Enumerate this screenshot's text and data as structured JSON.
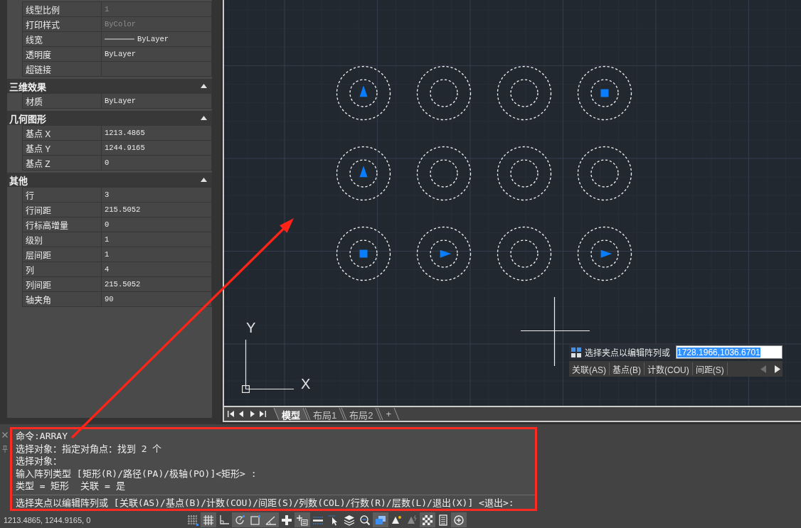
{
  "properties": {
    "sections": [
      {
        "rows": [
          {
            "label": "线型比例",
            "value": "1",
            "kind": "text",
            "disabled": true
          },
          {
            "label": "打印样式",
            "value": "ByColor",
            "kind": "text",
            "disabled": true
          },
          {
            "label": "线宽",
            "value": "ByLayer",
            "kind": "lineweight",
            "disabled": false
          },
          {
            "label": "透明度",
            "value": "ByLayer",
            "kind": "text",
            "disabled": false
          },
          {
            "label": "超链接",
            "kind": "text"
          }
        ]
      },
      {
        "title": "三维效果",
        "expanded": true,
        "rows": [
          {
            "label": "材质",
            "value": "ByLayer",
            "kind": "text",
            "disabled": false
          }
        ]
      },
      {
        "title": "几何图形",
        "expanded": true,
        "rows": [
          {
            "label": "基点 X",
            "value": "1213.4865",
            "kind": "text",
            "disabled": false
          },
          {
            "label": "基点 Y",
            "value": "1244.9165",
            "kind": "text",
            "disabled": false
          },
          {
            "label": "基点 Z",
            "value": "0",
            "kind": "text",
            "disabled": false
          }
        ]
      },
      {
        "title": "其他",
        "expanded": true,
        "rows": [
          {
            "label": "行",
            "value": "3",
            "kind": "text",
            "disabled": false
          },
          {
            "label": "行间距",
            "value": "215.5052",
            "kind": "text",
            "disabled": false
          },
          {
            "label": "行标高增量",
            "value": "0",
            "kind": "text",
            "disabled": false
          },
          {
            "label": "级别",
            "value": "1",
            "kind": "text",
            "disabled": false
          },
          {
            "label": "层间距",
            "value": "1",
            "kind": "text",
            "disabled": false
          },
          {
            "label": "列",
            "value": "4",
            "kind": "text",
            "disabled": false
          },
          {
            "label": "列间距",
            "value": "215.5052",
            "kind": "text",
            "disabled": false
          },
          {
            "label": "轴夹角",
            "value": "90",
            "kind": "text",
            "disabled": false
          }
        ]
      }
    ]
  },
  "drawing": {
    "array": {
      "rows": [
        {
          "cells": [
            {
              "kind": "up"
            },
            {
              "kind": "plain"
            },
            {
              "kind": "plain"
            },
            {
              "kind": "square"
            }
          ]
        },
        {
          "cells": [
            {
              "kind": "up"
            },
            {
              "kind": "plain"
            },
            {
              "kind": "plain"
            },
            {
              "kind": "plain"
            }
          ]
        },
        {
          "cells": [
            {
              "kind": "square"
            },
            {
              "kind": "right"
            },
            {
              "kind": "plain"
            },
            {
              "kind": "right"
            }
          ]
        }
      ]
    },
    "ucs_icon": {
      "x_label": "X",
      "y_label": "Y"
    },
    "dynamic_input": {
      "prompt": "选择夹点以编辑阵列或",
      "value": "1728.1966,1036.6701",
      "value_highlighted": true,
      "options": [
        "关联(AS)",
        "基点(B)",
        "计数(COU)",
        "间距(S)"
      ],
      "scroll_buttons": [
        {
          "disabled": true
        },
        {
          "disabled": false
        }
      ]
    }
  },
  "layout_tabs": {
    "tabs": [
      {
        "label": "模型",
        "selected": true
      },
      {
        "label": "布局1",
        "selected": false
      },
      {
        "label": "布局2",
        "selected": false
      }
    ],
    "add_tab": "+"
  },
  "command_line": {
    "history": [
      "命令:ARRAY",
      "选择对象：指定对角点：找到 2 个",
      "选择对象：",
      "输入阵列类型 [矩形(R)/路径(PA)/极轴(PO)]<矩形> :",
      "类型 = 矩形  关联 = 是"
    ],
    "prompt": "选择夹点以编辑阵列或 [关联(AS)/基点(B)/计数(COU)/间距(S)/列数(COL)/行数(R)/层数(L)/退出(X)] <退出>:"
  },
  "status_bar": {
    "coordinates": "1213.4865, 1244.9165, 0",
    "toggles": [
      {
        "kind": "gridsnap",
        "on": false
      },
      {
        "kind": "grid",
        "on": true
      },
      {
        "kind": "ortho",
        "on": false
      },
      {
        "kind": "polar",
        "on": true
      },
      {
        "kind": "osnap",
        "on": true
      },
      {
        "kind": "angle",
        "on": true
      },
      {
        "kind": "cross",
        "on": false
      },
      {
        "kind": "dyninput",
        "on": true
      },
      {
        "kind": "lineweight",
        "on": false
      },
      {
        "kind": "cursor",
        "on": false
      },
      {
        "kind": "layers",
        "on": false
      },
      {
        "kind": "zoom",
        "on": false
      },
      {
        "kind": "monitor",
        "on": true
      },
      {
        "kind": "annovisible",
        "on": false
      },
      {
        "kind": "annoscale",
        "on": false
      },
      {
        "kind": "transparency",
        "on": true
      },
      {
        "kind": "calculator",
        "on": false
      },
      {
        "kind": "add",
        "on": true
      }
    ]
  }
}
